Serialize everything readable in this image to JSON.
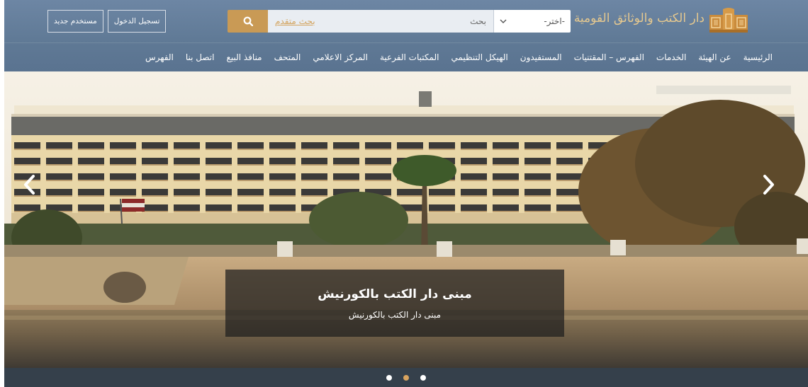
{
  "header": {
    "logo_text": "دار الكتب والوثائق القومية",
    "search": {
      "select_label": "-اختر-",
      "input_label": "بحث",
      "advanced_link": "بحث متقدم"
    },
    "auth": {
      "new_user": "مستخدم جديد",
      "login": "تسجيل الدخول"
    }
  },
  "nav": {
    "items": [
      {
        "label": "الرئيسية"
      },
      {
        "label": "عن الهيئة"
      },
      {
        "label": "الخدمات"
      },
      {
        "label": "الفهرس – المقتنيات"
      },
      {
        "label": "المستفيدون"
      },
      {
        "label": "الهيكل التنظيمي"
      },
      {
        "label": "المكتبات الفرعية"
      },
      {
        "label": "المركز الاعلامي"
      },
      {
        "label": "المتحف"
      },
      {
        "label": "منافذ البيع"
      },
      {
        "label": "اتصل بنا"
      },
      {
        "label": "الفهرس"
      }
    ]
  },
  "hero": {
    "caption_title": "مبنى دار الكتب بالكورنيش",
    "caption_subtitle": "مبنى دار الكتب بالكورنيش"
  },
  "carousel": {
    "slide_count": 3,
    "active_index": 1
  },
  "colors": {
    "header_bg": "#5f7995",
    "accent": "#c99a55",
    "footer_bar": "#35404b"
  }
}
